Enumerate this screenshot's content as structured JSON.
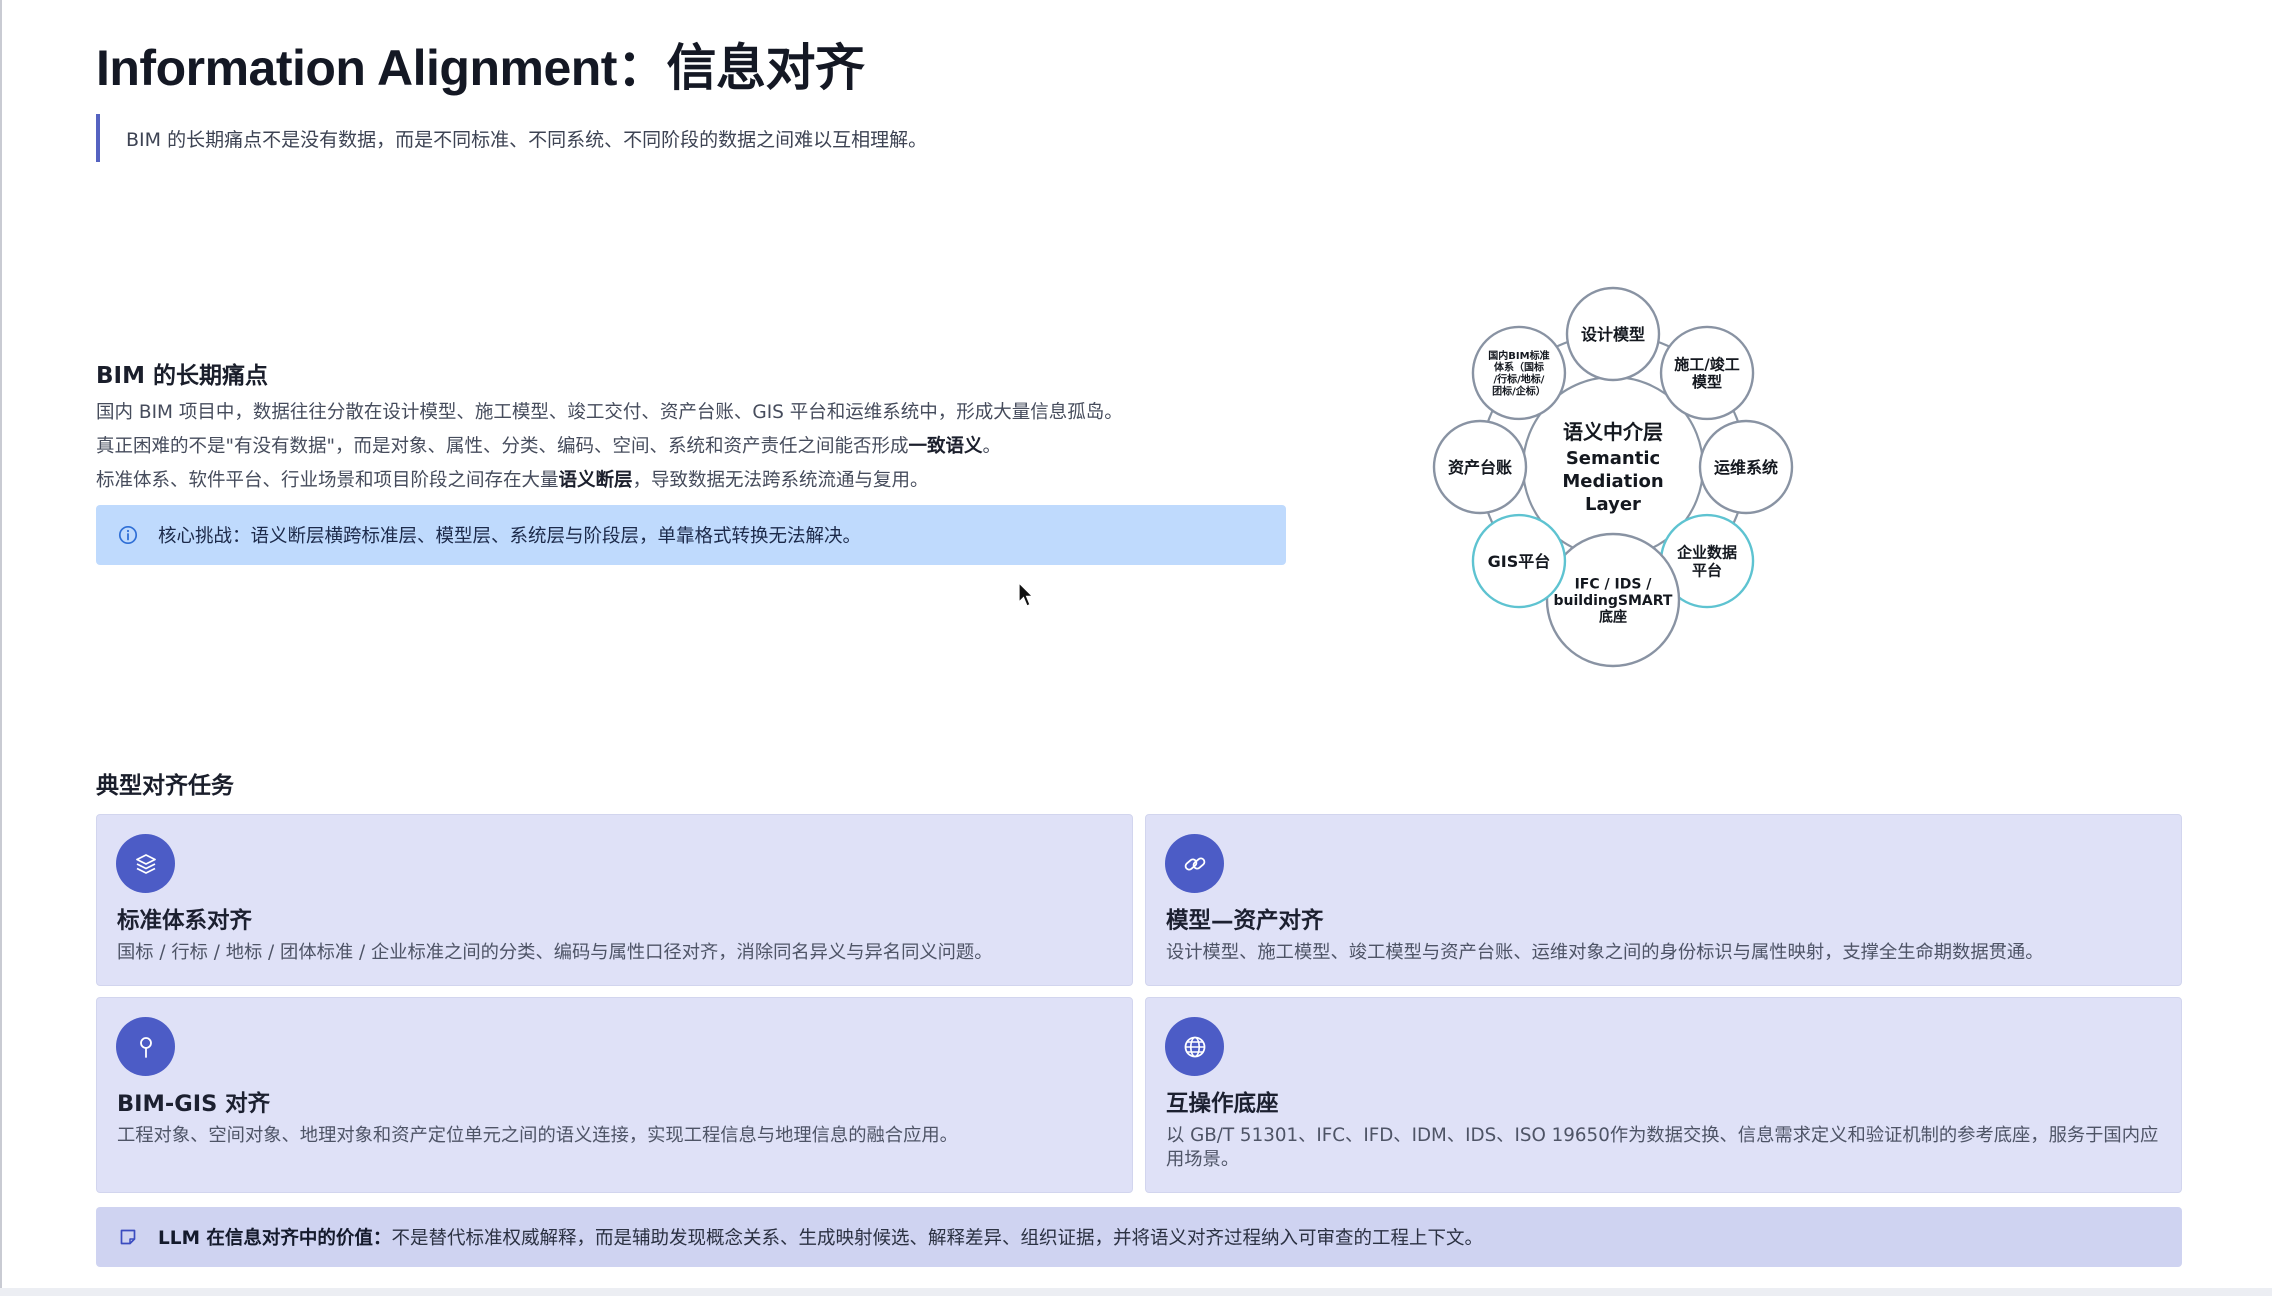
{
  "header": {
    "title": "Information Alignment：信息对齐",
    "lead": "BIM 的长期痛点不是没有数据，而是不同标准、不同系统、不同阶段的数据之间难以互相理解。"
  },
  "pain": {
    "heading": "BIM 的长期痛点",
    "line1": "国内 BIM 项目中，数据往往分散在设计模型、施工模型、竣工交付、资产台账、GIS 平台和运维系统中，形成大量信息孤岛。",
    "line2_pre": "真正困难的不是\"有没有数据\"，而是对象、属性、分类、编码、空间、系统和资产责任之间能否形成",
    "line2_bold": "一致语义",
    "line2_post": "。",
    "line3_pre": "标准体系、软件平台、行业场景和项目阶段之间存在大量",
    "line3_bold": "语义断层",
    "line3_post": "，导致数据无法跨系统流通与复用。",
    "callout": "核心挑战：语义断层横跨标准层、模型层、系统层与阶段层，单靠格式转换无法解决。"
  },
  "diagram": {
    "center": [
      "语义中介层",
      "Semantic",
      "Mediation",
      "Layer"
    ],
    "nodes": [
      {
        "id": "design",
        "lines": [
          "设计模型"
        ],
        "color": "#8993a3"
      },
      {
        "id": "construction",
        "lines": [
          "施工/竣工",
          "模型"
        ],
        "color": "#8993a3"
      },
      {
        "id": "om",
        "lines": [
          "运维系统"
        ],
        "color": "#8993a3"
      },
      {
        "id": "enterprise",
        "lines": [
          "企业数据",
          "平台"
        ],
        "color": "#5ec3d1"
      },
      {
        "id": "ifc",
        "lines": [
          "IFC / IDS /",
          "buildingSMART",
          "底座"
        ],
        "color": "#8993a3"
      },
      {
        "id": "gis",
        "lines": [
          "GIS平台"
        ],
        "color": "#5ec3d1"
      },
      {
        "id": "assets",
        "lines": [
          "资产台账"
        ],
        "color": "#8993a3"
      },
      {
        "id": "standards",
        "lines": [
          "国内BIM标准",
          "体系（国标",
          "/行标/地标/",
          "团标/企标）"
        ],
        "color": "#8993a3"
      }
    ]
  },
  "tasks": {
    "heading": "典型对齐任务",
    "cards": [
      {
        "icon": "layers-icon",
        "title": "标准体系对齐",
        "desc": "国标 / 行标 / 地标 / 团体标准 / 企业标准之间的分类、编码与属性口径对齐，消除同名异义与异名同义问题。"
      },
      {
        "icon": "link-icon",
        "title": "模型—资产对齐",
        "desc": "设计模型、施工模型、竣工模型与资产台账、运维对象之间的身份标识与属性映射，支撑全生命期数据贯通。"
      },
      {
        "icon": "map-pin-icon",
        "title": "BIM-GIS 对齐",
        "desc": "工程对象、空间对象、地理对象和资产定位单元之间的语义连接，实现工程信息与地理信息的融合应用。"
      },
      {
        "icon": "globe-icon",
        "title": "互操作底座",
        "desc": "以 GB/T 51301、IFC、IFD、IDM、IDS、ISO 19650作为数据交换、信息需求定义和验证机制的参考底座，服务于国内应用场景。"
      }
    ]
  },
  "llm": {
    "label": "LLM 在信息对齐中的价值：",
    "text": "不是替代标准权威解释，而是辅助发现概念关系、生成映射候选、解释差异、组织证据，并将语义对齐过程纳入可审查的工程上下文。"
  },
  "colors": {
    "accent": "#4c5cc6",
    "callout_bg": "#bfdafd",
    "card_bg": "#dfe1f7",
    "llm_bg": "#cfd3f1",
    "teal": "#5ec3d1"
  }
}
